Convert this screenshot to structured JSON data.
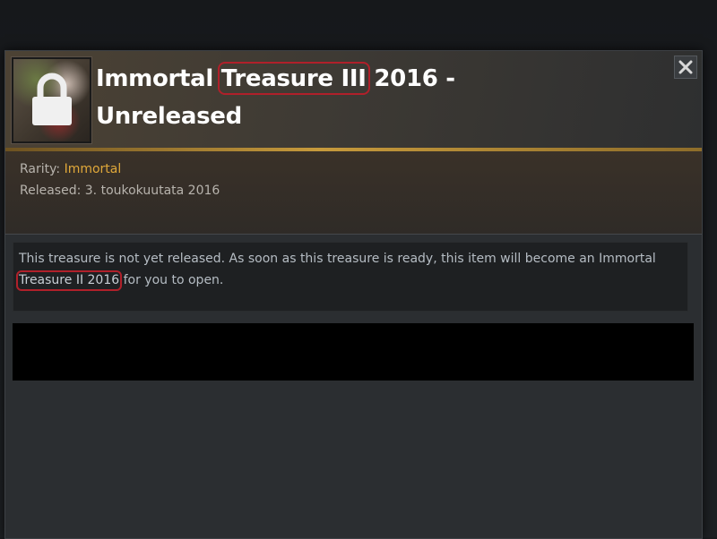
{
  "dialog": {
    "title_part1": "Immortal",
    "title_highlight": "Treasure III",
    "title_part2": "2016 -",
    "title_line2": "Unreleased",
    "close_label": "close",
    "icons": {
      "close": "close-icon",
      "lock": "lock-icon"
    }
  },
  "meta": {
    "rarity_label": "Rarity:",
    "rarity_value": "Immortal",
    "released_label": "Released:",
    "released_value": "3. toukokuutata 2016"
  },
  "description": {
    "text_before": "This treasure is not yet released. As soon as this treasure is ready, this item will become an Immortal",
    "highlight": "Treasure II 2016",
    "text_after": "for you to open."
  },
  "colors": {
    "accent_gold": "#e0a83a",
    "highlight_red": "#b0202a",
    "panel_bg": "#2b2e31"
  }
}
